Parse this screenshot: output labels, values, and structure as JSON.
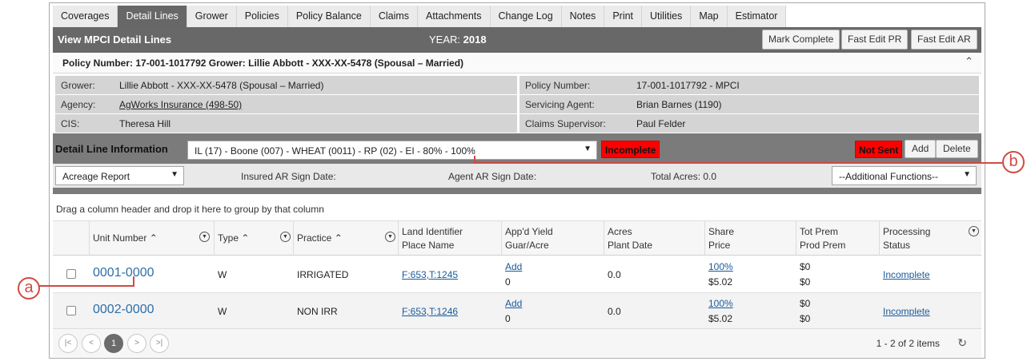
{
  "tabs": [
    "Coverages",
    "Detail Lines",
    "Grower",
    "Policies",
    "Policy Balance",
    "Claims",
    "Attachments",
    "Change Log",
    "Notes",
    "Print",
    "Utilities",
    "Map",
    "Estimator"
  ],
  "active_tab": "Detail Lines",
  "header": {
    "title": "View MPCI Detail Lines",
    "year_label": "YEAR:",
    "year_value": "2018",
    "buttons": [
      "Mark Complete",
      "Fast Edit PR",
      "Fast Edit AR"
    ]
  },
  "policy_title": "Policy Number: 17-001-1017792 Grower: Lillie Abbott - XXX-XX-5478 (Spousal – Married)",
  "info": {
    "grower_label": "Grower:",
    "grower_value": "Lillie Abbott - XXX-XX-5478 (Spousal – Married)",
    "agency_label": "Agency:",
    "agency_value": "AgWorks Insurance (498-50)",
    "cis_label": "CIS:",
    "cis_value": "Theresa Hill",
    "policy_label": "Policy Number:",
    "policy_value": "17-001-1017792 - MPCI",
    "agent_label": "Servicing Agent:",
    "agent_value": "Brian Barnes (1190)",
    "supervisor_label": "Claims Supervisor:",
    "supervisor_value": "Paul Felder"
  },
  "detail": {
    "title": "Detail Line Information",
    "line_select": "IL (17) - Boone (007) - WHEAT (0011) - RP (02) - EI - 80% - 100%",
    "status_badge": "Incomplete",
    "sent_badge": "Not Sent",
    "add_label": "Add",
    "delete_label": "Delete",
    "report_select": "Acreage Report",
    "insured_ar": "Insured AR Sign Date:",
    "agent_ar": "Agent AR Sign Date:",
    "total_acres": "Total Acres: 0.0",
    "additional_functions": "--Additional Functions--"
  },
  "group_hint": "Drag a column header and drop it here to group by that column",
  "columns": {
    "unit": "Unit Number",
    "type": "Type",
    "practice": "Practice",
    "land_1": "Land Identifier",
    "land_2": "Place Name",
    "yield_1": "App'd Yield",
    "yield_2": "Guar/Acre",
    "acres_1": "Acres",
    "acres_2": "Plant Date",
    "share_1": "Share",
    "share_2": "Price",
    "prem_1": "Tot Prem",
    "prem_2": "Prod Prem",
    "proc_1": "Processing",
    "proc_2": "Status"
  },
  "rows": [
    {
      "unit": "0001-0000",
      "type": "W",
      "practice": "IRRIGATED",
      "land": "F:653,T:1245",
      "yield_link": "Add",
      "guar": "0",
      "acres": "0.0",
      "share": "100%",
      "price": "$5.02",
      "tot_prem": "$0",
      "prod_prem": "$0",
      "status": "Incomplete"
    },
    {
      "unit": "0002-0000",
      "type": "W",
      "practice": "NON IRR",
      "land": "F:653,T:1246",
      "yield_link": "Add",
      "guar": "0",
      "acres": "0.0",
      "share": "100%",
      "price": "$5.02",
      "tot_prem": "$0",
      "prod_prem": "$0",
      "status": "Incomplete"
    }
  ],
  "pager": {
    "current_page": "1",
    "info": "1 - 2 of 2 items"
  },
  "callouts": {
    "a": "a",
    "b": "b"
  },
  "colors": {
    "header_bg": "#686868",
    "badge_red": "#ff0000",
    "callout": "#d04a42",
    "link": "#1a5a9a"
  }
}
